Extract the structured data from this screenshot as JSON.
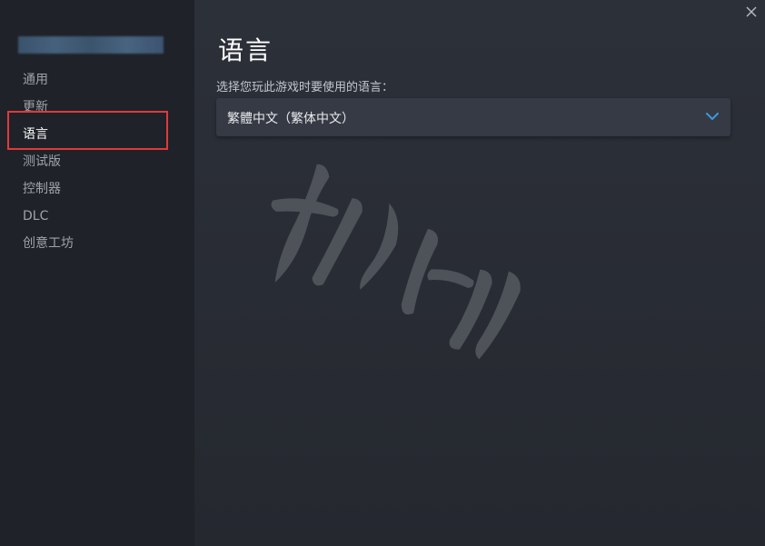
{
  "sidebar": {
    "items": [
      {
        "label": "通用",
        "active": false
      },
      {
        "label": "更新",
        "active": false
      },
      {
        "label": "语言",
        "active": true
      },
      {
        "label": "测试版",
        "active": false
      },
      {
        "label": "控制器",
        "active": false
      },
      {
        "label": "DLC",
        "active": false
      },
      {
        "label": "创意工坊",
        "active": false
      }
    ]
  },
  "main": {
    "title": "语言",
    "subtitle": "选择您玩此游戏时要使用的语言：",
    "language_select": {
      "value": "繁體中文（繁体中文）"
    }
  },
  "icons": {
    "close": "close-icon",
    "dropdown": "chevron-down-icon"
  },
  "colors": {
    "accent": "#3b9ae1",
    "highlight_box": "#e0393b",
    "sidebar_bg": "#1f2228",
    "main_bg": "#2a2d35"
  }
}
